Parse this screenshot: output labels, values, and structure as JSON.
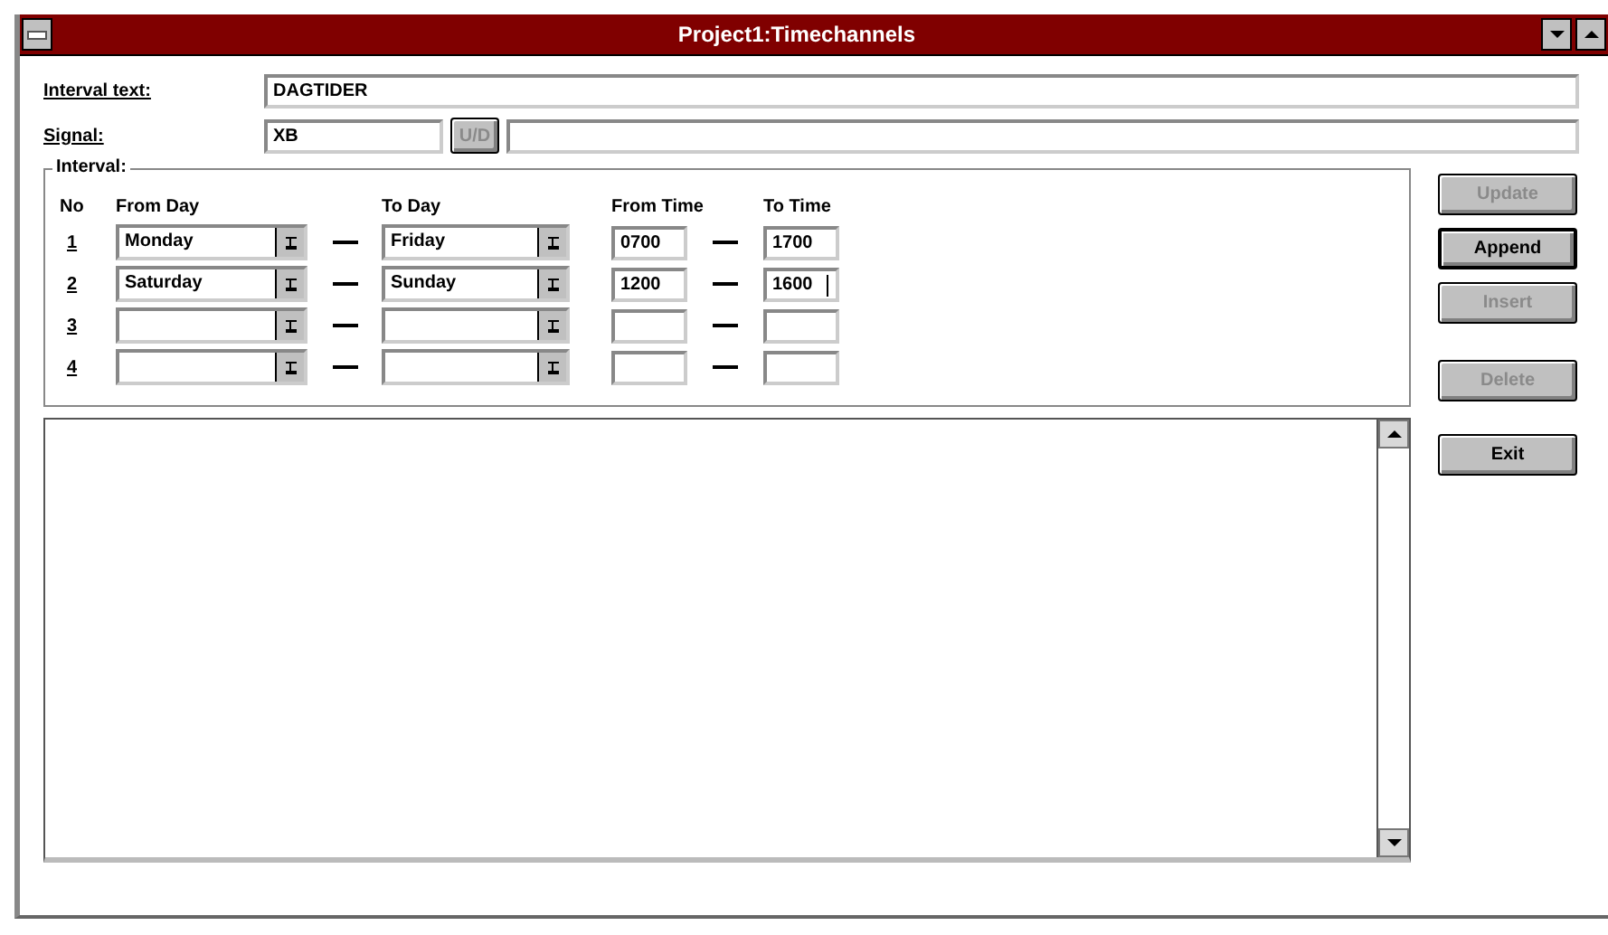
{
  "window": {
    "title": "Project1:Timechannels"
  },
  "interval_text": {
    "label": "Interval text:",
    "value": "DAGTIDER"
  },
  "signal": {
    "label": "Signal:",
    "value": "XB",
    "button": {
      "label": "U/D",
      "disabled": true
    }
  },
  "interval": {
    "title": "Interval:",
    "columns": [
      "No",
      "From Day",
      "To Day",
      "From Time",
      "To Time"
    ],
    "rows": [
      {
        "no": "1",
        "from_day": "Monday",
        "to_day": "Friday",
        "from_time": "0700",
        "to_time": "1700",
        "focused": false
      },
      {
        "no": "2",
        "from_day": "Saturday",
        "to_day": "Sunday",
        "from_time": "1200",
        "to_time": "1600",
        "focused": true
      },
      {
        "no": "3",
        "focused": false
      },
      {
        "no": "4",
        "focused": false
      }
    ]
  },
  "buttons": [
    {
      "label": "Update",
      "disabled": true,
      "default": false
    },
    {
      "label": "Append",
      "disabled": false,
      "default": true
    },
    {
      "label": "Insert",
      "disabled": true,
      "default": false
    },
    {
      "label": "Delete",
      "disabled": true,
      "default": false
    },
    {
      "label": "Exit",
      "disabled": false,
      "default": false
    }
  ]
}
